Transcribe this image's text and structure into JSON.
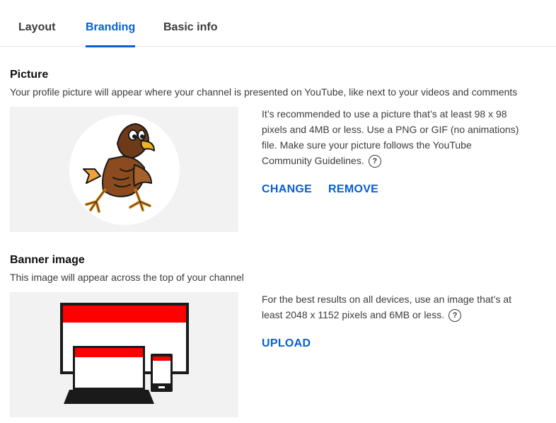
{
  "tabs": [
    {
      "label": "Layout",
      "active": false
    },
    {
      "label": "Branding",
      "active": true
    },
    {
      "label": "Basic info",
      "active": false
    }
  ],
  "picture": {
    "title": "Picture",
    "description": "Your profile picture will appear where your channel is presented on YouTube, like next to your videos and comments",
    "info": "It’s recommended to use a picture that’s at least 98 x 98 pixels and 4MB or less. Use a PNG or GIF (no animations) file. Make sure your picture follows the YouTube Community Guidelines.",
    "change_label": "CHANGE",
    "remove_label": "REMOVE"
  },
  "banner": {
    "title": "Banner image",
    "description": "This image will appear across the top of your channel",
    "info": "For the best results on all devices, use an image that’s at least 2048 x 1152 pixels and 6MB or less.",
    "upload_label": "UPLOAD"
  },
  "colors": {
    "accent": "#065fd4",
    "banner_red": "#ff0000",
    "preview_bg": "#f2f2f2"
  },
  "icons": {
    "help": "help-circle-icon",
    "avatar": "eagle-mascot-avatar"
  },
  "help_glyph": "?"
}
